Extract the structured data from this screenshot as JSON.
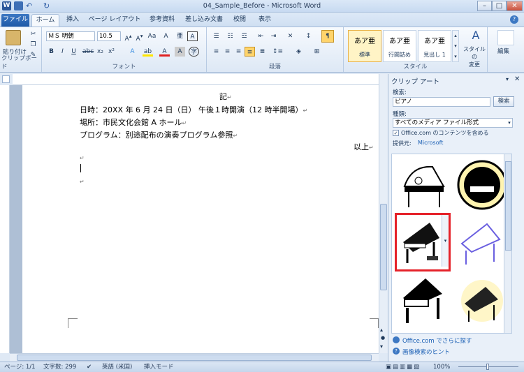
{
  "window": {
    "title": "04_Sample_Before - Microsoft Word"
  },
  "tabs": [
    "ファイル",
    "ホーム",
    "挿入",
    "ページ レイアウト",
    "参考資料",
    "差し込み文書",
    "校閲",
    "表示"
  ],
  "ribbon": {
    "paste_label": "貼り付け",
    "font_name": "ＭＳ 明朝",
    "font_size": "10.5",
    "groups": [
      "クリップボード",
      "フォント",
      "段落",
      "スタイル"
    ],
    "styles": [
      {
        "preview": "あア亜",
        "name": "標準"
      },
      {
        "preview": "あア亜",
        "name": "行間詰め"
      },
      {
        "preview": "あア亜",
        "name": "見出し 1"
      }
    ],
    "style_change_label": "スタイルの\n変更",
    "edit_label": "編集"
  },
  "document": {
    "lines": [
      "記",
      "日時：20XX 年 6 月 24 日（日） 午後１時開演（12 時半開場）",
      "場所：市民文化会館 A ホール",
      "プログラム：別途配布の演奏プログラム参照",
      "以上"
    ],
    "marks": "↵"
  },
  "clipart_pane": {
    "title": "クリップ アート",
    "search_label": "検索:",
    "search_value": "ピアノ",
    "search_button": "検索",
    "type_label": "種類:",
    "type_value": "すべてのメディア ファイル形式",
    "include_label": "Office.com のコンテンツを含める",
    "include_checked": true,
    "provider_label": "提供元:",
    "provider_value": "Microsoft",
    "more_link": "Office.com でさらに探す",
    "hint_link": "画像検索のヒント"
  },
  "status": {
    "page": "ページ: 1/1",
    "words": "文字数: 299",
    "language": "英語 (米国)",
    "mode": "挿入モード",
    "zoom": "100%"
  },
  "colors": {
    "highlight": "#e5222a",
    "accent": "#2b579a"
  }
}
